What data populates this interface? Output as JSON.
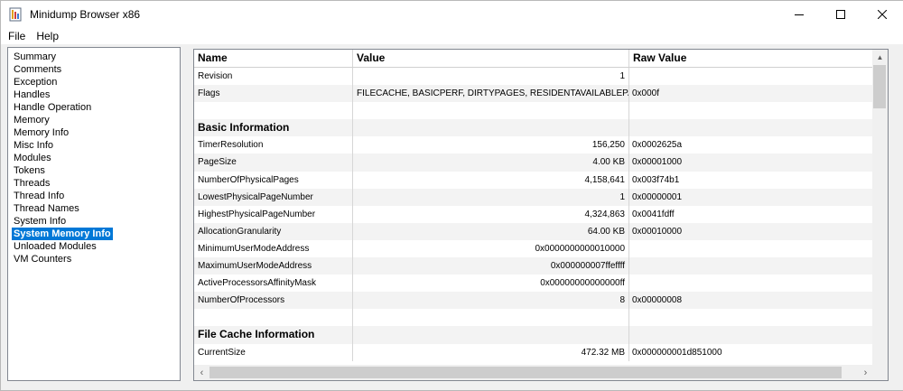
{
  "window": {
    "title": "Minidump Browser x86"
  },
  "menu": [
    "File",
    "Help"
  ],
  "tree": [
    "Summary",
    "Comments",
    "Exception",
    "Handles",
    "Handle Operation",
    "Memory",
    "Memory Info",
    "Misc Info",
    "Modules",
    "Tokens",
    "Threads",
    "Thread Info",
    "Thread Names",
    "System Info",
    "System Memory Info",
    "Unloaded Modules",
    "VM Counters"
  ],
  "selected_tree_index": 14,
  "columns": {
    "name": "Name",
    "value": "Value",
    "raw": "Raw Value"
  },
  "rows": [
    {
      "name": "Revision",
      "value": "1",
      "raw": ""
    },
    {
      "name": "Flags",
      "value": "FILECACHE, BASICPERF, DIRTYPAGES, RESIDENTAVAILABLEPAGES",
      "raw": "0x000f",
      "valueAlign": "left"
    },
    {
      "name": "",
      "value": "",
      "raw": ""
    },
    {
      "name": "Basic Information",
      "value": "",
      "raw": "",
      "section": true
    },
    {
      "name": "TimerResolution",
      "value": "156,250",
      "raw": "0x0002625a"
    },
    {
      "name": "PageSize",
      "value": "4.00 KB",
      "raw": "0x00001000"
    },
    {
      "name": "NumberOfPhysicalPages",
      "value": "4,158,641",
      "raw": "0x003f74b1"
    },
    {
      "name": "LowestPhysicalPageNumber",
      "value": "1",
      "raw": "0x00000001"
    },
    {
      "name": "HighestPhysicalPageNumber",
      "value": "4,324,863",
      "raw": "0x0041fdff"
    },
    {
      "name": "AllocationGranularity",
      "value": "64.00 KB",
      "raw": "0x00010000"
    },
    {
      "name": "MinimumUserModeAddress",
      "value": "0x0000000000010000",
      "raw": ""
    },
    {
      "name": "MaximumUserModeAddress",
      "value": "0x000000007ffeffff",
      "raw": ""
    },
    {
      "name": "ActiveProcessorsAffinityMask",
      "value": "0x00000000000000ff",
      "raw": ""
    },
    {
      "name": "NumberOfProcessors",
      "value": "8",
      "raw": "0x00000008"
    },
    {
      "name": "",
      "value": "",
      "raw": ""
    },
    {
      "name": "File Cache Information",
      "value": "",
      "raw": "",
      "section": true
    },
    {
      "name": "CurrentSize",
      "value": "472.32 MB",
      "raw": "0x000000001d851000"
    }
  ]
}
